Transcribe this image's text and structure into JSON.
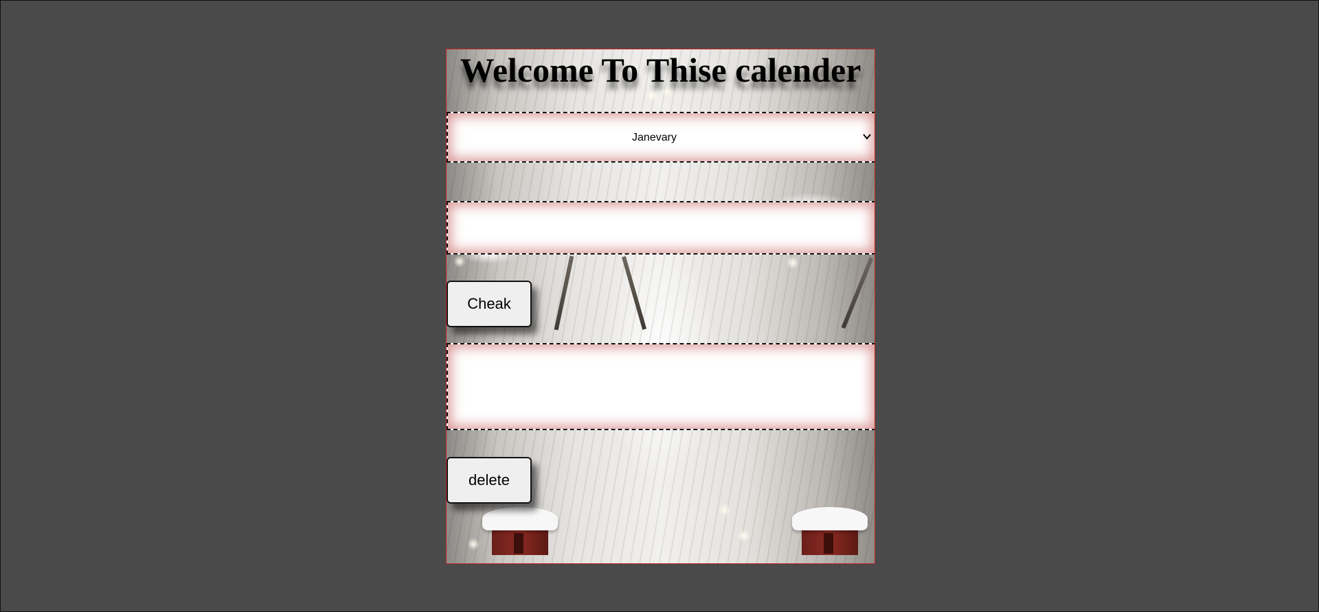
{
  "header": {
    "title": "Welcome To Thise calender"
  },
  "month_select": {
    "selected": "Janevary"
  },
  "date_input": {
    "value": ""
  },
  "buttons": {
    "check_label": "Cheak",
    "delete_label": "delete"
  },
  "output": {
    "value": ""
  },
  "colors": {
    "page_background": "#4a4a4a",
    "panel_border": "#c62828",
    "band_glow": "#c45c5c",
    "button_face": "#efefef"
  },
  "icons": {
    "select_arrow": "chevron-down-icon"
  }
}
